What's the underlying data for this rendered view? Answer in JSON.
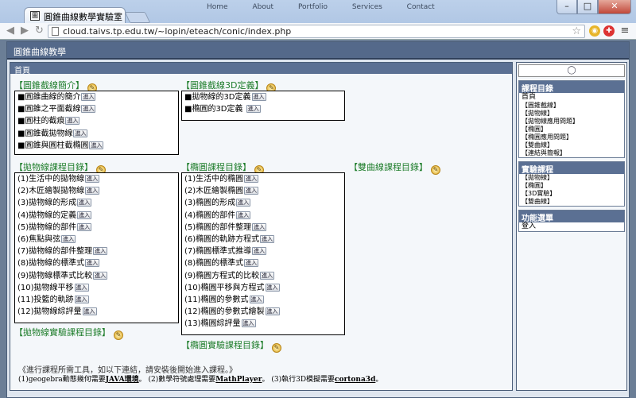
{
  "browser": {
    "tab_title": "圓錐曲線數學實驗室",
    "tab_close": "×",
    "site_nav": [
      "Home",
      "About",
      "Portfolio",
      "Services",
      "Contact"
    ],
    "url": "cloud.taivs.tp.edu.tw/~lopin/eteach/conic/index.php",
    "window_minimize": "–",
    "window_maximize": "□",
    "window_close": "✕"
  },
  "site": {
    "title": "圓錐曲線教學",
    "main_header": "首頁"
  },
  "sections": {
    "intro": {
      "title": "【圓錐截線簡介】",
      "items": [
        "■圓錐曲線的簡介",
        "■圓錐之平面截線",
        "■圓柱的截痕",
        "■圓錐截拋物線",
        "■圓錐與圓柱截橢圓"
      ]
    },
    "def3d": {
      "title": "【圓錐截線3D定義】",
      "items": [
        "■拋物線的3D定義",
        "■橢圓的3D定義 "
      ]
    },
    "parabola": {
      "title": "【拋物線課程目錄】",
      "items": [
        "(1)生活中的拋物線",
        "(2)木匠繪製拋物線",
        "(3)拋物線的形成",
        "(4)拋物線的定義",
        "(5)拋物線的部件",
        "(6)焦點與弦",
        "(7)拋物線的部件整理",
        "(8)拋物線的標準式",
        "(9)拋物線標準式比較",
        "(10)拋物線平移",
        "(11)投籃的軌跡",
        "(12)拋物線綜評量"
      ]
    },
    "ellipse": {
      "title": "【橢圓課程目錄】",
      "items": [
        "(1)生活中的橢圓",
        "(2)木匠繪製橢圓",
        "(3)橢圓的形成",
        "(4)橢圓的部件",
        "(5)橢圓的部件整理",
        "(6)橢圓的軌跡方程式",
        "(7)橢圓標準式推導",
        "(8)橢圓的標準式",
        "(9)橢圓方程式的比較",
        "(10)橢圓平移與方程式",
        "(11)橢圓的參數式",
        "(12)橢圓的參數式繪製",
        "(13)橢圓綜評量"
      ]
    },
    "hyperbola": {
      "title": "【雙曲線課程目錄】"
    },
    "parabola_lab": {
      "title": "【拋物線實驗課程目錄】"
    },
    "ellipse_lab": {
      "title": "【橢圓實驗課程目錄】"
    }
  },
  "enter_label": "進入",
  "footer": {
    "line1": "《進行課程所需工具，如以下連結，請安裝後開始進入課程。》",
    "line2_a": "(1)geogebra動態幾何需要",
    "line2_link1": "JAVA環境",
    "line2_b": "。 (2)數學符號處理需要",
    "line2_link2": "MathPlayer",
    "line2_c": "。 (3)執行3D模擬需要",
    "line2_link3": "cortona3d",
    "line2_d": "。"
  },
  "sidebar": {
    "course_menu": {
      "title": "課程目錄",
      "items": [
        "首頁",
        "【圓錐截線】",
        "【拋物線】",
        "【拋物線應用問題】",
        "【橢圓】",
        "【橢圓應用問題】",
        "【雙曲線】",
        "【連結與簡報】"
      ]
    },
    "lab_courses": {
      "title": "實驗課程",
      "items": [
        "【拋物線】",
        "【橢圓】",
        "【3D實驗】",
        "【雙曲線】"
      ]
    },
    "function_menu": {
      "title": "功能選單",
      "items": [
        "登入"
      ]
    }
  },
  "colors": {
    "section_title": "#1f7e2c",
    "header_bar": "#5b7093",
    "page_bg": "#dfe6ef"
  }
}
